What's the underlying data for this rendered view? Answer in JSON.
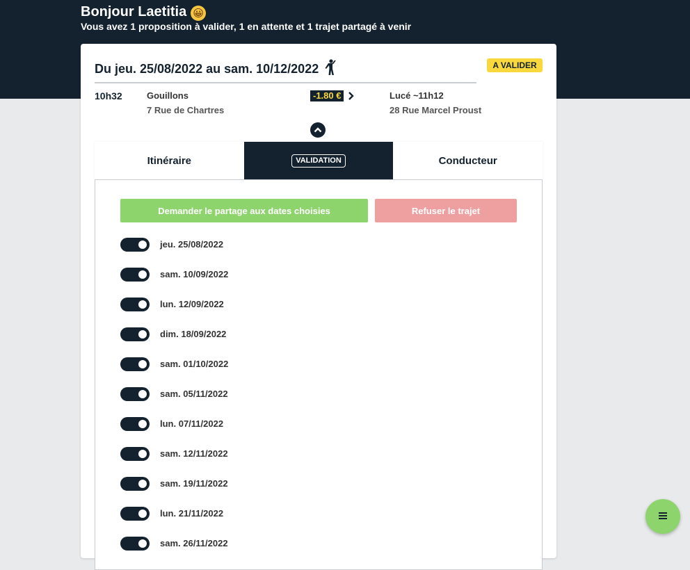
{
  "header": {
    "greeting": "Bonjour Laetitia",
    "emoji": "😀",
    "summary": "Vous avez 1 proposition à valider, 1 en attente et 1 trajet partagé à venir"
  },
  "trip": {
    "title": "Du jeu. 25/08/2022 au sam. 10/12/2022",
    "passenger_icon": "walking-person-icon",
    "status_badge": "A VALIDER",
    "departure_time": "10h32",
    "departure_place": "Gouillons",
    "departure_address": "7 Rue de Chartres",
    "price": "-1.80 €",
    "arrival_place": "Lucé ~11h12",
    "arrival_address": "28 Rue Marcel Proust"
  },
  "tabs": [
    {
      "label": "Itinéraire"
    },
    {
      "label": "VALIDATION"
    },
    {
      "label": "Conducteur"
    }
  ],
  "actions": {
    "accept_label": "Demander le partage aux dates choisies",
    "refuse_label": "Refuser le trajet"
  },
  "dates": [
    {
      "label": "jeu. 25/08/2022",
      "checked": true
    },
    {
      "label": "sam. 10/09/2022",
      "checked": true
    },
    {
      "label": "lun. 12/09/2022",
      "checked": true
    },
    {
      "label": "dim. 18/09/2022",
      "checked": true
    },
    {
      "label": "sam. 01/10/2022",
      "checked": true
    },
    {
      "label": "sam. 05/11/2022",
      "checked": true
    },
    {
      "label": "lun. 07/11/2022",
      "checked": true
    },
    {
      "label": "sam. 12/11/2022",
      "checked": true
    },
    {
      "label": "sam. 19/11/2022",
      "checked": true
    },
    {
      "label": "lun. 21/11/2022",
      "checked": true
    },
    {
      "label": "sam. 26/11/2022",
      "checked": true
    }
  ],
  "colors": {
    "navy": "#13222e",
    "yellow": "#f9d83e",
    "green": "#8dd46c",
    "red_light": "#ee9fa0"
  },
  "fab_icon": "menu-icon"
}
